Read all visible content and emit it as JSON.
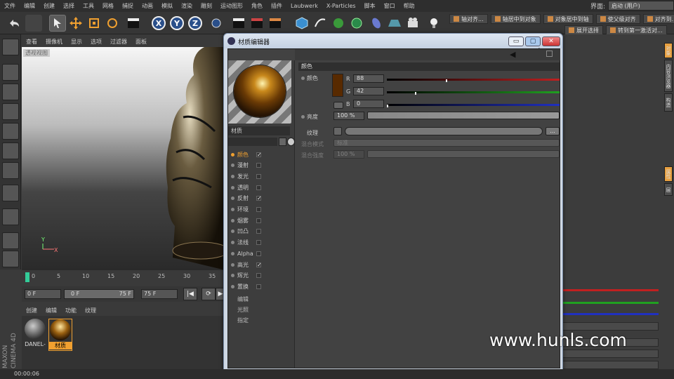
{
  "menubar": {
    "items": [
      "文件",
      "编辑",
      "创建",
      "选择",
      "工具",
      "网格",
      "捕捉",
      "动画",
      "模拟",
      "渲染",
      "雕刻",
      "运动图形",
      "角色",
      "插件",
      "Laubwerk",
      "X-Particles",
      "脚本",
      "窗口",
      "帮助"
    ],
    "layout_label": "界面:",
    "layout_value": "启动 (用户)"
  },
  "toolbar": {
    "x_label": "X",
    "y_label": "Y",
    "z_label": "Z",
    "commands_row1": [
      "轴对齐...",
      "轴居中到对象",
      "对象居中到轴",
      "使父级对齐",
      "对齐到..."
    ],
    "commands_row2": [
      "展开选择",
      "转到第一激活对..."
    ]
  },
  "viewport": {
    "menu": [
      "查看",
      "摄像机",
      "显示",
      "选项",
      "过滤器",
      "面板"
    ],
    "label": "透视视图",
    "axis_y": "Y",
    "axis_x": "X"
  },
  "timeline": {
    "ticks": [
      "0",
      "5",
      "10",
      "15",
      "20",
      "25",
      "30",
      "35"
    ],
    "start_frame": "0 F",
    "current_frame": "0 F",
    "range_end": "75 F",
    "end_frame": "75 F"
  },
  "material_manager": {
    "menu": [
      "创建",
      "编辑",
      "功能",
      "纹理"
    ],
    "materials": [
      {
        "name": "DANEL-"
      },
      {
        "name": "材质"
      }
    ]
  },
  "branding": "MAXON CINEMA 4D",
  "status": {
    "time": "00:00:06"
  },
  "dialog": {
    "title": "材质编辑器",
    "material_name": "材质",
    "channels": [
      {
        "label": "颜色",
        "checked": true,
        "selected": true
      },
      {
        "label": "漫射",
        "checked": false
      },
      {
        "label": "发光",
        "checked": false
      },
      {
        "label": "透明",
        "checked": false
      },
      {
        "label": "反射",
        "checked": true
      },
      {
        "label": "环境",
        "checked": false
      },
      {
        "label": "烟雾",
        "checked": false
      },
      {
        "label": "凹凸",
        "checked": false
      },
      {
        "label": "法线",
        "checked": false
      },
      {
        "label": "Alpha",
        "checked": false
      },
      {
        "label": "高光",
        "checked": true
      },
      {
        "label": "辉光",
        "checked": false
      },
      {
        "label": "置换",
        "checked": false
      }
    ],
    "extras": [
      "编辑",
      "光照",
      "指定"
    ],
    "section_title": "颜色",
    "color": {
      "label": "颜色",
      "swatch": "#582a00",
      "r_label": "R",
      "r_value": "88",
      "g_label": "G",
      "g_value": "42",
      "b_label": "B",
      "b_value": "0",
      "r_fraction": 0.345,
      "g_fraction": 0.165,
      "b_fraction": 0.0
    },
    "brightness": {
      "label": "亮度",
      "value": "100 %"
    },
    "texture": {
      "label": "纹理",
      "button": "..."
    },
    "blend_mode": {
      "label": "混合模式",
      "value": "标准"
    },
    "blend_strength": {
      "label": "混合强度",
      "value": "100 %"
    }
  },
  "right_panel_tabs": [
    "对象",
    "内容浏览器",
    "构造",
    "属性",
    "层"
  ],
  "watermark": "www.hunls.com",
  "colors": {
    "accent": "#f0a030",
    "r_slider": "#c02020",
    "g_slider": "#20a020",
    "b_slider": "#2030c0"
  }
}
